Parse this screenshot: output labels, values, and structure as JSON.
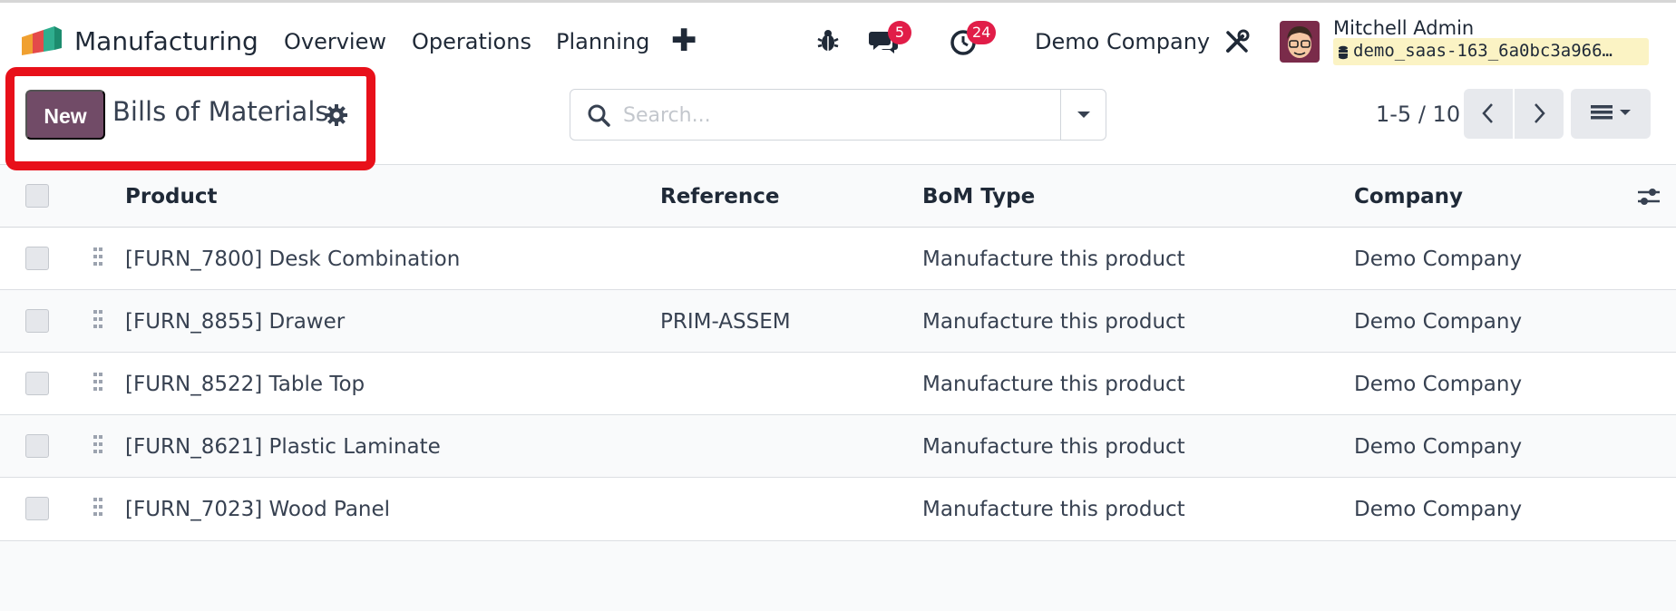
{
  "app": {
    "name": "Manufacturing"
  },
  "menu": {
    "items": [
      "Overview",
      "Operations",
      "Planning"
    ],
    "add_symbol": "✚"
  },
  "systray": {
    "messages_count": "5",
    "activities_count": "24",
    "company": "Demo Company"
  },
  "user": {
    "name": "Mitchell Admin",
    "database": "demo_saas-163_6a0bc3a966…"
  },
  "controls": {
    "new_label": "New",
    "title": "Bills of Materials",
    "search_placeholder": "Search...",
    "pager": "1-5 / 10"
  },
  "table": {
    "headers": [
      "Product",
      "Reference",
      "BoM Type",
      "Company"
    ],
    "rows": [
      {
        "product": "[FURN_7800] Desk Combination",
        "reference": "",
        "bom_type": "Manufacture this product",
        "company": "Demo Company"
      },
      {
        "product": "[FURN_8855] Drawer",
        "reference": "PRIM-ASSEM",
        "bom_type": "Manufacture this product",
        "company": "Demo Company"
      },
      {
        "product": "[FURN_8522] Table Top",
        "reference": "",
        "bom_type": "Manufacture this product",
        "company": "Demo Company"
      },
      {
        "product": "[FURN_8621] Plastic Laminate",
        "reference": "",
        "bom_type": "Manufacture this product",
        "company": "Demo Company"
      },
      {
        "product": "[FURN_7023] Wood Panel",
        "reference": "",
        "bom_type": "Manufacture this product",
        "company": "Demo Company"
      }
    ]
  },
  "colors": {
    "brand_primary": "#714b67",
    "badge": "#e11d48",
    "highlight": "#e8101a",
    "db_tag_bg": "#fbf3c4"
  },
  "icons": [
    "manufacturing-logo-icon",
    "bug-icon",
    "chat-icon",
    "clock-icon",
    "tools-icon",
    "gear-icon",
    "search-icon",
    "caret-down-icon",
    "chevron-left-icon",
    "chevron-right-icon",
    "list-view-icon",
    "optional-columns-icon",
    "drag-handle-icon",
    "database-icon"
  ]
}
